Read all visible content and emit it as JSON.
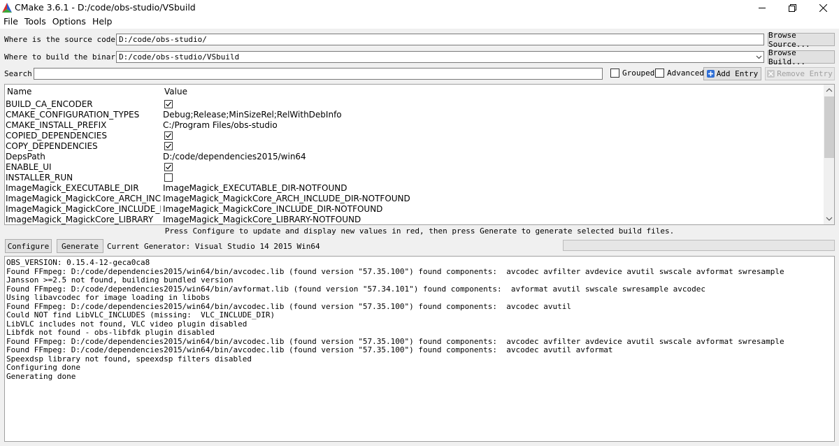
{
  "window": {
    "title": "CMake 3.6.1 - D:/code/obs-studio/VSbuild"
  },
  "menu": [
    "File",
    "Tools",
    "Options",
    "Help"
  ],
  "source": {
    "label": "Where is the source code:",
    "value": "D:/code/obs-studio/",
    "button": "Browse Source..."
  },
  "build": {
    "label": "Where to build the binaries:",
    "value": "D:/code/obs-studio/VSbuild",
    "button": "Browse Build..."
  },
  "search": {
    "label": "Search:",
    "value": "",
    "grouped_label": "Grouped",
    "grouped_checked": false,
    "advanced_label": "Advanced",
    "advanced_checked": false,
    "add_entry": "Add Entry",
    "remove_entry": "Remove Entry"
  },
  "table": {
    "headers": [
      "Name",
      "Value"
    ],
    "rows": [
      {
        "name": "BUILD_CA_ENCODER",
        "type": "bool",
        "checked": true
      },
      {
        "name": "CMAKE_CONFIGURATION_TYPES",
        "type": "text",
        "value": "Debug;Release;MinSizeRel;RelWithDebInfo"
      },
      {
        "name": "CMAKE_INSTALL_PREFIX",
        "type": "text",
        "value": "C:/Program Files/obs-studio"
      },
      {
        "name": "COPIED_DEPENDENCIES",
        "type": "bool",
        "checked": true
      },
      {
        "name": "COPY_DEPENDENCIES",
        "type": "bool",
        "checked": true
      },
      {
        "name": "DepsPath",
        "type": "text",
        "value": "D:/code/dependencies2015/win64"
      },
      {
        "name": "ENABLE_UI",
        "type": "bool",
        "checked": true
      },
      {
        "name": "INSTALLER_RUN",
        "type": "bool",
        "checked": false
      },
      {
        "name": "ImageMagick_EXECUTABLE_DIR",
        "type": "text",
        "value": "ImageMagick_EXECUTABLE_DIR-NOTFOUND"
      },
      {
        "name": "ImageMagick_MagickCore_ARCH_INCL...",
        "type": "text",
        "value": "ImageMagick_MagickCore_ARCH_INCLUDE_DIR-NOTFOUND"
      },
      {
        "name": "ImageMagick_MagickCore_INCLUDE_D...",
        "type": "text",
        "value": "ImageMagick_MagickCore_INCLUDE_DIR-NOTFOUND"
      },
      {
        "name": "ImageMagick_MagickCore_LIBRARY",
        "type": "text",
        "value": "ImageMagick_MagickCore_LIBRARY-NOTFOUND"
      }
    ]
  },
  "hint": "Press Configure to update and display new values in red, then press Generate to generate selected build files.",
  "actions": {
    "configure": "Configure",
    "generate": "Generate",
    "generator": "Current Generator: Visual Studio 14 2015 Win64"
  },
  "output": [
    "OBS_VERSION: 0.15.4-12-geca0ca8",
    "Found FFmpeg: D:/code/dependencies2015/win64/bin/avcodec.lib (found version \"57.35.100\") found components:  avcodec avfilter avdevice avutil swscale avformat swresample",
    "Jansson >=2.5 not found, building bundled version",
    "Found FFmpeg: D:/code/dependencies2015/win64/bin/avformat.lib (found version \"57.34.101\") found components:  avformat avutil swscale swresample avcodec",
    "Using libavcodec for image loading in libobs",
    "Found FFmpeg: D:/code/dependencies2015/win64/bin/avcodec.lib (found version \"57.35.100\") found components:  avcodec avutil",
    "Could NOT find LibVLC_INCLUDES (missing:  VLC_INCLUDE_DIR)",
    "LibVLC includes not found, VLC video plugin disabled",
    "Libfdk not found - obs-libfdk plugin disabled",
    "Found FFmpeg: D:/code/dependencies2015/win64/bin/avcodec.lib (found version \"57.35.100\") found components:  avcodec avfilter avdevice avutil swscale avformat swresample",
    "Found FFmpeg: D:/code/dependencies2015/win64/bin/avcodec.lib (found version \"57.35.100\") found components:  avcodec avutil avformat",
    "Speexdsp library not found, speexdsp filters disabled",
    "Configuring done",
    "Generating done"
  ]
}
